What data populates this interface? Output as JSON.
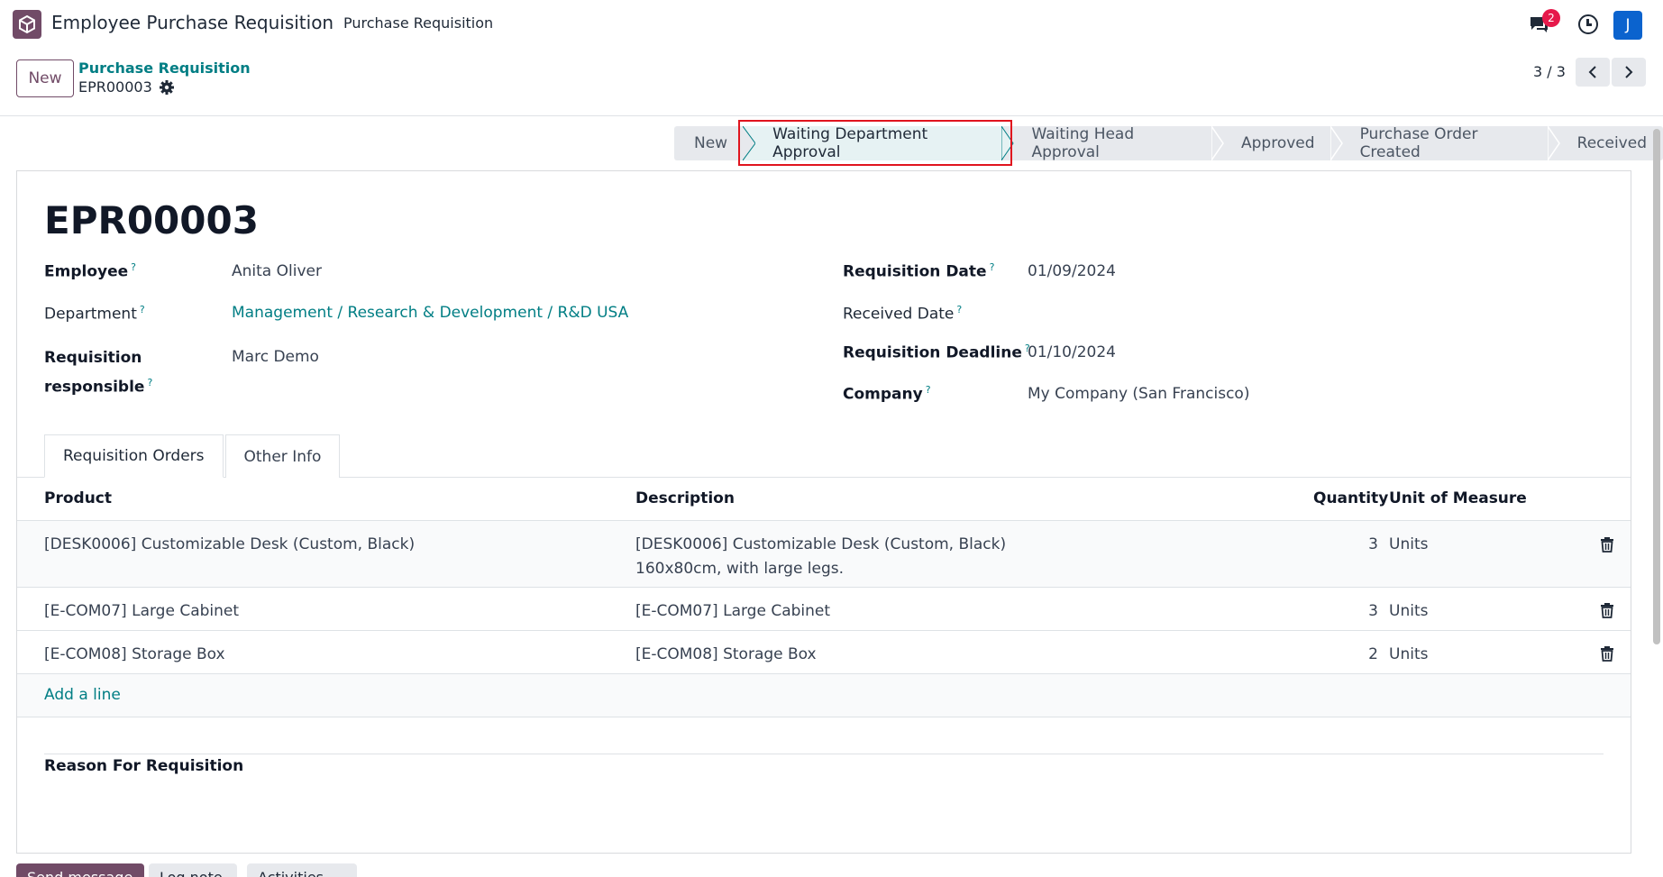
{
  "topnav": {
    "app_title": "Employee Purchase Requisition",
    "menu_item": "Purchase Requisition",
    "chat_badge": "2",
    "avatar_letter": "J"
  },
  "control": {
    "new_label": "New",
    "breadcrumb_parent": "Purchase Requisition",
    "breadcrumb_current": "EPR00003",
    "pager": "3 / 3"
  },
  "statusbar": {
    "stages": [
      "New",
      "Waiting Department Approval",
      "Waiting Head Approval",
      "Approved",
      "Purchase Order Created",
      "Received"
    ],
    "active_stage": "Waiting Department Approval"
  },
  "form": {
    "title": "EPR00003",
    "left": {
      "employee_label": "Employee",
      "employee_value": "Anita Oliver",
      "department_label": "Department",
      "department_value": "Management / Research & Development / R&D USA",
      "responsible_label_1": "Requisition",
      "responsible_label_2": "responsible",
      "responsible_value": "Marc Demo"
    },
    "right": {
      "req_date_label": "Requisition Date",
      "req_date_value": "01/09/2024",
      "received_date_label": "Received Date",
      "received_date_value": "",
      "deadline_label": "Requisition Deadline",
      "deadline_value": "01/10/2024",
      "company_label": "Company",
      "company_value": "My Company (San Francisco)"
    },
    "help_mark": "?"
  },
  "tabs": [
    "Requisition Orders",
    "Other Info"
  ],
  "table": {
    "headers": {
      "product": "Product",
      "description": "Description",
      "quantity": "Quantity",
      "uom": "Unit of Measure"
    },
    "rows": [
      {
        "product": "[DESK0006] Customizable Desk (Custom, Black)",
        "description_1": "[DESK0006] Customizable Desk (Custom, Black)",
        "description_2": "160x80cm, with large legs.",
        "quantity": "3",
        "uom": "Units"
      },
      {
        "product": "[E-COM07] Large Cabinet",
        "description_1": "[E-COM07] Large Cabinet",
        "description_2": "",
        "quantity": "3",
        "uom": "Units"
      },
      {
        "product": "[E-COM08] Storage Box",
        "description_1": "[E-COM08] Storage Box",
        "description_2": "",
        "quantity": "2",
        "uom": "Units"
      }
    ],
    "add_line": "Add a line"
  },
  "reason_label": "Reason For Requisition",
  "chatter": {
    "send": "Send message",
    "log": "Log note",
    "activities": "Activities"
  },
  "colors": {
    "brand": "#714b67",
    "link": "#017e84",
    "highlight": "#e0141e",
    "active_stage": "#e6f2f3"
  }
}
